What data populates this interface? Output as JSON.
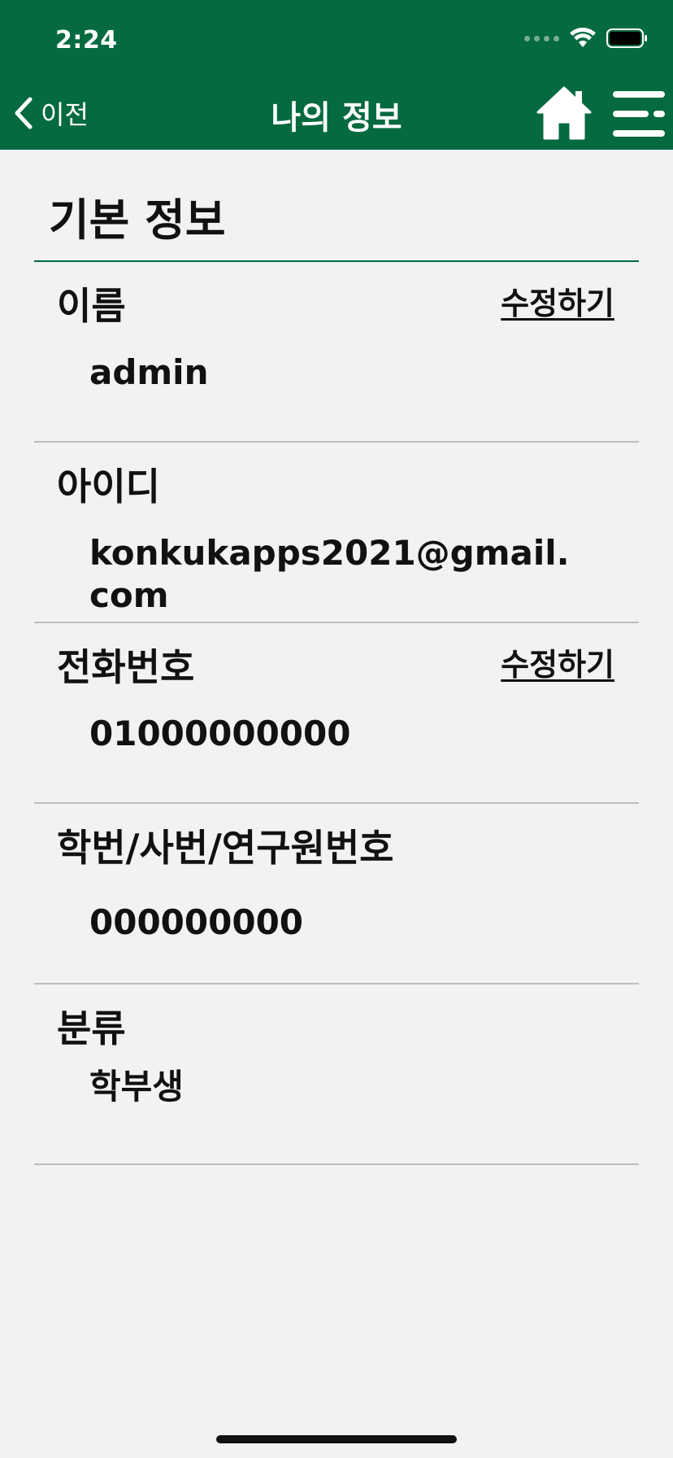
{
  "status_bar": {
    "time": "2:24"
  },
  "nav": {
    "back_label": "이전",
    "title": "나의 정보"
  },
  "section": {
    "title": "기본 정보"
  },
  "fields": [
    {
      "label": "이름",
      "value": "admin",
      "edit_label": "수정하기"
    },
    {
      "label": "아이디",
      "value": "konkukapps2021@gmail.com"
    },
    {
      "label": "전화번호",
      "value": "01000000000",
      "edit_label": "수정하기"
    },
    {
      "label": "학번/사번/연구원번호",
      "value": "000000000"
    },
    {
      "label": "분류",
      "value": "학부생"
    }
  ],
  "colors": {
    "header_bg": "#056a3f",
    "page_bg": "#f2f2f2",
    "divider": "#bdbdbd"
  },
  "icons": {
    "back": "chevron-left-icon",
    "home": "home-icon",
    "menu": "menu-icon",
    "wifi": "wifi-icon",
    "battery": "battery-icon",
    "signal": "signal-icon"
  }
}
